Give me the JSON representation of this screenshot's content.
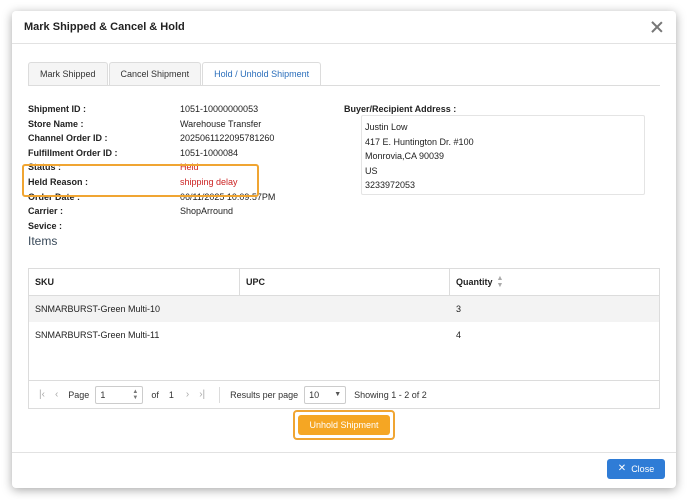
{
  "modal": {
    "title": "Mark Shipped & Cancel & Hold"
  },
  "tabs": [
    {
      "label": "Mark Shipped"
    },
    {
      "label": "Cancel Shipment"
    },
    {
      "label": "Hold / Unhold Shipment"
    }
  ],
  "info": [
    {
      "label": "Shipment ID :",
      "value": "1051-10000000053"
    },
    {
      "label": "Store Name :",
      "value": "Warehouse Transfer"
    },
    {
      "label": "Channel Order ID :",
      "value": "2025061122095781260"
    },
    {
      "label": "Fulfillment Order ID :",
      "value": "1051-1000084"
    },
    {
      "label": "Status :",
      "value": "Held"
    },
    {
      "label": "Held Reason :",
      "value": "shipping delay"
    },
    {
      "label": "Order Date :",
      "value": "06/11/2025 10:09:57PM"
    },
    {
      "label": "Carrier :",
      "value": "ShopArround"
    },
    {
      "label": "Sevice :",
      "value": ""
    }
  ],
  "address": {
    "label": "Buyer/Recipient Address :",
    "lines": [
      "Justin Low",
      "417 E. Huntington Dr. #100",
      "Monrovia,CA 90039",
      "US",
      "3233972053"
    ]
  },
  "items": {
    "title": "Items",
    "columns": [
      "SKU",
      "UPC",
      "Quantity"
    ],
    "rows": [
      {
        "sku": "SNMARBURST-Green Multi-10",
        "upc": "",
        "qty": "3"
      },
      {
        "sku": "SNMARBURST-Green Multi-11",
        "upc": "",
        "qty": "4"
      }
    ]
  },
  "pager": {
    "page_label": "Page",
    "page_value": "1",
    "of_label": "of",
    "total_pages": "1",
    "rpp_label": "Results per page",
    "rpp_value": "10",
    "showing": "Showing 1 - 2 of 2"
  },
  "actions": {
    "unhold": "Unhold Shipment",
    "close": "Close"
  },
  "colors": {
    "accent": "#2f7cd6",
    "warning": "#f5a623",
    "highlight": "#f0a532",
    "danger": "#cc2222"
  }
}
